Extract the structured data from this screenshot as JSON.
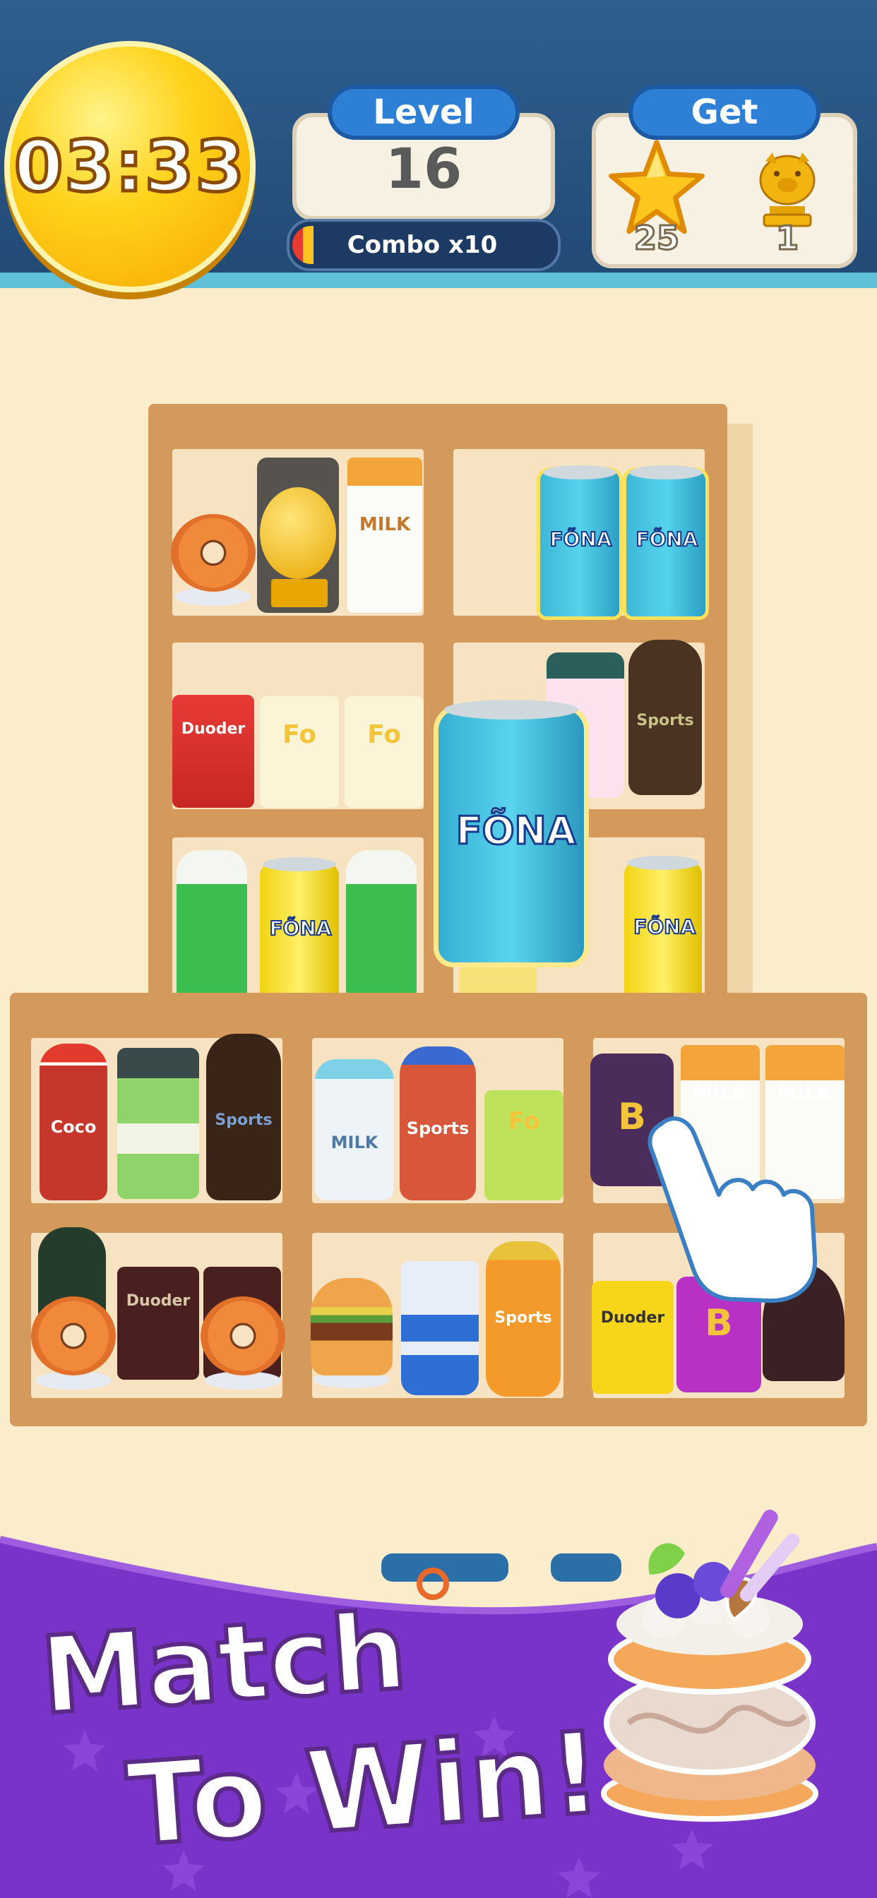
{
  "hud": {
    "timer": "03:33",
    "level_label": "Level",
    "level_number": "16",
    "combo_text": "Combo x10",
    "get_label": "Get",
    "star_count": "25",
    "pig_count": "1"
  },
  "items": {
    "milk": "MILK",
    "fona": "FÕNA",
    "duoder": "Duoder",
    "focc": "Fo",
    "sports": "Sports",
    "coco": "Coco",
    "b_label": "B"
  },
  "banner": {
    "line1": "Match",
    "line2": "To Win!"
  },
  "colors": {
    "hud_bg": "#2a5685",
    "accent_blue": "#2e7fd6",
    "timer_yellow": "#ffd31c",
    "shelf_wood": "#d39a5c",
    "banner_purple": "#7a33c8"
  }
}
